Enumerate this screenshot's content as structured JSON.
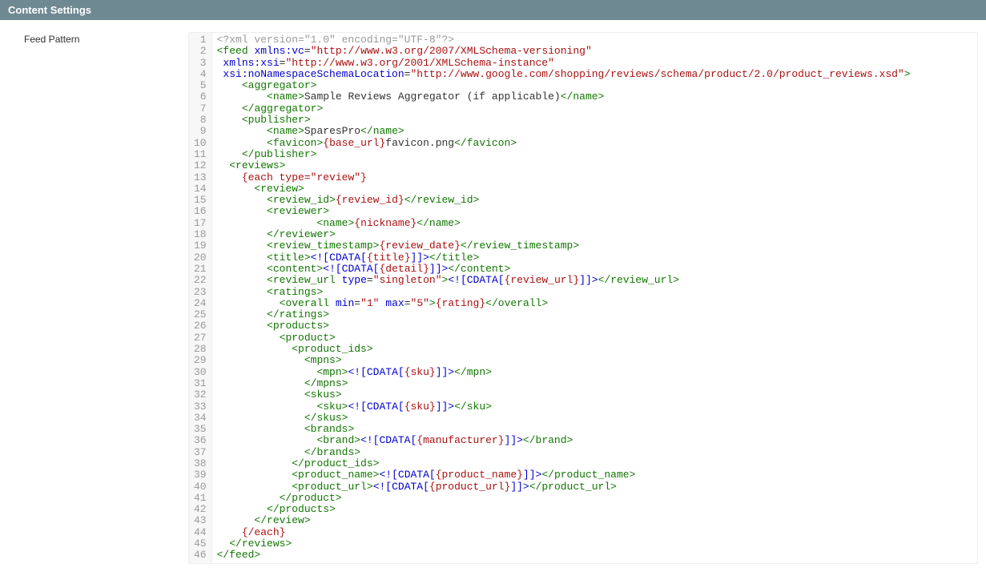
{
  "section": {
    "title": "Content Settings"
  },
  "form": {
    "feed_pattern_label": "Feed Pattern"
  },
  "code": {
    "lines": [
      [
        [
          "pi",
          "<?xml version=\"1.0\" encoding=\"UTF-8\"?>"
        ]
      ],
      [
        [
          "br",
          "<"
        ],
        [
          "t",
          "feed"
        ],
        [
          "tx",
          " "
        ],
        [
          "an",
          "xmlns:vc"
        ],
        [
          "tx",
          "="
        ],
        [
          "av",
          "\"http://www.w3.org/2007/XMLSchema-versioning\""
        ]
      ],
      [
        [
          "tx",
          " "
        ],
        [
          "an",
          "xmlns:xsi"
        ],
        [
          "tx",
          "="
        ],
        [
          "av",
          "\"http://www.w3.org/2001/XMLSchema-instance\""
        ]
      ],
      [
        [
          "tx",
          " "
        ],
        [
          "an",
          "xsi:noNamespaceSchemaLocation"
        ],
        [
          "tx",
          "="
        ],
        [
          "av",
          "\"http://www.google.com/shopping/reviews/schema/product/2.0/product_reviews.xsd\""
        ],
        [
          "br",
          ">"
        ]
      ],
      [
        [
          "tx",
          "    "
        ],
        [
          "br",
          "<"
        ],
        [
          "t",
          "aggregator"
        ],
        [
          "br",
          ">"
        ]
      ],
      [
        [
          "tx",
          "        "
        ],
        [
          "br",
          "<"
        ],
        [
          "t",
          "name"
        ],
        [
          "br",
          ">"
        ],
        [
          "tx",
          "Sample Reviews Aggregator (if applicable)"
        ],
        [
          "br",
          "</"
        ],
        [
          "t",
          "name"
        ],
        [
          "br",
          ">"
        ]
      ],
      [
        [
          "tx",
          "    "
        ],
        [
          "br",
          "</"
        ],
        [
          "t",
          "aggregator"
        ],
        [
          "br",
          ">"
        ]
      ],
      [
        [
          "tx",
          "    "
        ],
        [
          "br",
          "<"
        ],
        [
          "t",
          "publisher"
        ],
        [
          "br",
          ">"
        ]
      ],
      [
        [
          "tx",
          "        "
        ],
        [
          "br",
          "<"
        ],
        [
          "t",
          "name"
        ],
        [
          "br",
          ">"
        ],
        [
          "tx",
          "SparesPro"
        ],
        [
          "br",
          "</"
        ],
        [
          "t",
          "name"
        ],
        [
          "br",
          ">"
        ]
      ],
      [
        [
          "tx",
          "        "
        ],
        [
          "br",
          "<"
        ],
        [
          "t",
          "favicon"
        ],
        [
          "br",
          ">"
        ],
        [
          "hb",
          "{base_url}"
        ],
        [
          "tx",
          "favicon.png"
        ],
        [
          "br",
          "</"
        ],
        [
          "t",
          "favicon"
        ],
        [
          "br",
          ">"
        ]
      ],
      [
        [
          "tx",
          "    "
        ],
        [
          "br",
          "</"
        ],
        [
          "t",
          "publisher"
        ],
        [
          "br",
          ">"
        ]
      ],
      [
        [
          "tx",
          "  "
        ],
        [
          "br",
          "<"
        ],
        [
          "t",
          "reviews"
        ],
        [
          "br",
          ">"
        ]
      ],
      [
        [
          "tx",
          "    "
        ],
        [
          "hb",
          "{each type=\"review\"}"
        ]
      ],
      [
        [
          "tx",
          "      "
        ],
        [
          "br",
          "<"
        ],
        [
          "t",
          "review"
        ],
        [
          "br",
          ">"
        ]
      ],
      [
        [
          "tx",
          "        "
        ],
        [
          "br",
          "<"
        ],
        [
          "t",
          "review_id"
        ],
        [
          "br",
          ">"
        ],
        [
          "hb",
          "{review_id}"
        ],
        [
          "br",
          "</"
        ],
        [
          "t",
          "review_id"
        ],
        [
          "br",
          ">"
        ]
      ],
      [
        [
          "tx",
          "        "
        ],
        [
          "br",
          "<"
        ],
        [
          "t",
          "reviewer"
        ],
        [
          "br",
          ">"
        ]
      ],
      [
        [
          "tx",
          "                "
        ],
        [
          "br",
          "<"
        ],
        [
          "t",
          "name"
        ],
        [
          "br",
          ">"
        ],
        [
          "hb",
          "{nickname}"
        ],
        [
          "br",
          "</"
        ],
        [
          "t",
          "name"
        ],
        [
          "br",
          ">"
        ]
      ],
      [
        [
          "tx",
          "        "
        ],
        [
          "br",
          "</"
        ],
        [
          "t",
          "reviewer"
        ],
        [
          "br",
          ">"
        ]
      ],
      [
        [
          "tx",
          "        "
        ],
        [
          "br",
          "<"
        ],
        [
          "t",
          "review_timestamp"
        ],
        [
          "br",
          ">"
        ],
        [
          "hb",
          "{review_date}"
        ],
        [
          "br",
          "</"
        ],
        [
          "t",
          "review_timestamp"
        ],
        [
          "br",
          ">"
        ]
      ],
      [
        [
          "tx",
          "        "
        ],
        [
          "br",
          "<"
        ],
        [
          "t",
          "title"
        ],
        [
          "br",
          ">"
        ],
        [
          "cd",
          "<![CDATA["
        ],
        [
          "hb",
          "{title}"
        ],
        [
          "cd",
          "]]>"
        ],
        [
          "br",
          "</"
        ],
        [
          "t",
          "title"
        ],
        [
          "br",
          ">"
        ]
      ],
      [
        [
          "tx",
          "        "
        ],
        [
          "br",
          "<"
        ],
        [
          "t",
          "content"
        ],
        [
          "br",
          ">"
        ],
        [
          "cd",
          "<![CDATA["
        ],
        [
          "hb",
          "{detail}"
        ],
        [
          "cd",
          "]]>"
        ],
        [
          "br",
          "</"
        ],
        [
          "t",
          "content"
        ],
        [
          "br",
          ">"
        ]
      ],
      [
        [
          "tx",
          "        "
        ],
        [
          "br",
          "<"
        ],
        [
          "t",
          "review_url"
        ],
        [
          "tx",
          " "
        ],
        [
          "an",
          "type"
        ],
        [
          "tx",
          "="
        ],
        [
          "av",
          "\"singleton\""
        ],
        [
          "br",
          ">"
        ],
        [
          "cd",
          "<![CDATA["
        ],
        [
          "hb",
          "{review_url}"
        ],
        [
          "cd",
          "]]>"
        ],
        [
          "br",
          "</"
        ],
        [
          "t",
          "review_url"
        ],
        [
          "br",
          ">"
        ]
      ],
      [
        [
          "tx",
          "        "
        ],
        [
          "br",
          "<"
        ],
        [
          "t",
          "ratings"
        ],
        [
          "br",
          ">"
        ]
      ],
      [
        [
          "tx",
          "          "
        ],
        [
          "br",
          "<"
        ],
        [
          "t",
          "overall"
        ],
        [
          "tx",
          " "
        ],
        [
          "an",
          "min"
        ],
        [
          "tx",
          "="
        ],
        [
          "av",
          "\"1\""
        ],
        [
          "tx",
          " "
        ],
        [
          "an",
          "max"
        ],
        [
          "tx",
          "="
        ],
        [
          "av",
          "\"5\""
        ],
        [
          "br",
          ">"
        ],
        [
          "hb",
          "{rating}"
        ],
        [
          "br",
          "</"
        ],
        [
          "t",
          "overall"
        ],
        [
          "br",
          ">"
        ]
      ],
      [
        [
          "tx",
          "        "
        ],
        [
          "br",
          "</"
        ],
        [
          "t",
          "ratings"
        ],
        [
          "br",
          ">"
        ]
      ],
      [
        [
          "tx",
          "        "
        ],
        [
          "br",
          "<"
        ],
        [
          "t",
          "products"
        ],
        [
          "br",
          ">"
        ]
      ],
      [
        [
          "tx",
          "          "
        ],
        [
          "br",
          "<"
        ],
        [
          "t",
          "product"
        ],
        [
          "br",
          ">"
        ]
      ],
      [
        [
          "tx",
          "            "
        ],
        [
          "br",
          "<"
        ],
        [
          "t",
          "product_ids"
        ],
        [
          "br",
          ">"
        ]
      ],
      [
        [
          "tx",
          "              "
        ],
        [
          "br",
          "<"
        ],
        [
          "t",
          "mpns"
        ],
        [
          "br",
          ">"
        ]
      ],
      [
        [
          "tx",
          "                "
        ],
        [
          "br",
          "<"
        ],
        [
          "t",
          "mpn"
        ],
        [
          "br",
          ">"
        ],
        [
          "cd",
          "<![CDATA["
        ],
        [
          "hb",
          "{sku}"
        ],
        [
          "cd",
          "]]>"
        ],
        [
          "br",
          "</"
        ],
        [
          "t",
          "mpn"
        ],
        [
          "br",
          ">"
        ]
      ],
      [
        [
          "tx",
          "              "
        ],
        [
          "br",
          "</"
        ],
        [
          "t",
          "mpns"
        ],
        [
          "br",
          ">"
        ]
      ],
      [
        [
          "tx",
          "              "
        ],
        [
          "br",
          "<"
        ],
        [
          "t",
          "skus"
        ],
        [
          "br",
          ">"
        ]
      ],
      [
        [
          "tx",
          "                "
        ],
        [
          "br",
          "<"
        ],
        [
          "t",
          "sku"
        ],
        [
          "br",
          ">"
        ],
        [
          "cd",
          "<![CDATA["
        ],
        [
          "hb",
          "{sku}"
        ],
        [
          "cd",
          "]]>"
        ],
        [
          "br",
          "</"
        ],
        [
          "t",
          "sku"
        ],
        [
          "br",
          ">"
        ]
      ],
      [
        [
          "tx",
          "              "
        ],
        [
          "br",
          "</"
        ],
        [
          "t",
          "skus"
        ],
        [
          "br",
          ">"
        ]
      ],
      [
        [
          "tx",
          "              "
        ],
        [
          "br",
          "<"
        ],
        [
          "t",
          "brands"
        ],
        [
          "br",
          ">"
        ]
      ],
      [
        [
          "tx",
          "                "
        ],
        [
          "br",
          "<"
        ],
        [
          "t",
          "brand"
        ],
        [
          "br",
          ">"
        ],
        [
          "cd",
          "<![CDATA["
        ],
        [
          "hb",
          "{manufacturer}"
        ],
        [
          "cd",
          "]]>"
        ],
        [
          "br",
          "</"
        ],
        [
          "t",
          "brand"
        ],
        [
          "br",
          ">"
        ]
      ],
      [
        [
          "tx",
          "              "
        ],
        [
          "br",
          "</"
        ],
        [
          "t",
          "brands"
        ],
        [
          "br",
          ">"
        ]
      ],
      [
        [
          "tx",
          "            "
        ],
        [
          "br",
          "</"
        ],
        [
          "t",
          "product_ids"
        ],
        [
          "br",
          ">"
        ]
      ],
      [
        [
          "tx",
          "            "
        ],
        [
          "br",
          "<"
        ],
        [
          "t",
          "product_name"
        ],
        [
          "br",
          ">"
        ],
        [
          "cd",
          "<![CDATA["
        ],
        [
          "hb",
          "{product_name}"
        ],
        [
          "cd",
          "]]>"
        ],
        [
          "br",
          "</"
        ],
        [
          "t",
          "product_name"
        ],
        [
          "br",
          ">"
        ]
      ],
      [
        [
          "tx",
          "            "
        ],
        [
          "br",
          "<"
        ],
        [
          "t",
          "product_url"
        ],
        [
          "br",
          ">"
        ],
        [
          "cd",
          "<![CDATA["
        ],
        [
          "hb",
          "{product_url}"
        ],
        [
          "cd",
          "]]>"
        ],
        [
          "br",
          "</"
        ],
        [
          "t",
          "product_url"
        ],
        [
          "br",
          ">"
        ]
      ],
      [
        [
          "tx",
          "          "
        ],
        [
          "br",
          "</"
        ],
        [
          "t",
          "product"
        ],
        [
          "br",
          ">"
        ]
      ],
      [
        [
          "tx",
          "        "
        ],
        [
          "br",
          "</"
        ],
        [
          "t",
          "products"
        ],
        [
          "br",
          ">"
        ]
      ],
      [
        [
          "tx",
          "      "
        ],
        [
          "br",
          "</"
        ],
        [
          "t",
          "review"
        ],
        [
          "br",
          ">"
        ]
      ],
      [
        [
          "tx",
          "    "
        ],
        [
          "hb",
          "{/each}"
        ]
      ],
      [
        [
          "tx",
          "  "
        ],
        [
          "br",
          "</"
        ],
        [
          "t",
          "reviews"
        ],
        [
          "br",
          ">"
        ]
      ],
      [
        [
          "br",
          "</"
        ],
        [
          "t",
          "feed"
        ],
        [
          "br",
          ">"
        ]
      ]
    ]
  }
}
